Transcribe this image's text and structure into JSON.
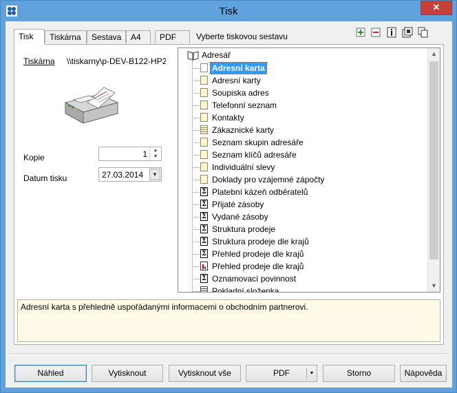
{
  "window": {
    "title": "Tisk",
    "close_label": "✕"
  },
  "tabs": [
    {
      "label": "Tisk",
      "active": true
    },
    {
      "label": "Tiskárna",
      "active": false
    },
    {
      "label": "Sestava",
      "active": false
    },
    {
      "label": "A4",
      "active": false
    },
    {
      "label": "PDF",
      "active": false
    }
  ],
  "tab_caption": "Vyberte tiskovou sestavu",
  "toolbar": [
    {
      "name": "add-icon"
    },
    {
      "name": "remove-icon"
    },
    {
      "name": "info-icon"
    },
    {
      "name": "copy-settings-icon"
    },
    {
      "name": "duplicate-icon"
    }
  ],
  "printer": {
    "label": "Tiskárna",
    "name": "\\\\tiskarny\\p-DEV-B122-HP2"
  },
  "copies": {
    "label": "Kopie",
    "value": "1"
  },
  "print_date": {
    "label": "Datum tisku",
    "value": "27.03.2014"
  },
  "tree": {
    "root": "Adresář",
    "items": [
      {
        "label": "Adresní karta",
        "icon": "white",
        "selected": true
      },
      {
        "label": "Adresní karty",
        "icon": "page"
      },
      {
        "label": "Soupiska adres",
        "icon": "page"
      },
      {
        "label": "Telefonní seznam",
        "icon": "page"
      },
      {
        "label": "Kontakty",
        "icon": "page"
      },
      {
        "label": "Zákaznické karty",
        "icon": "grid"
      },
      {
        "label": "Seznam skupin adresáře",
        "icon": "page"
      },
      {
        "label": "Seznam klíčů adresáře",
        "icon": "page"
      },
      {
        "label": "Individuální slevy",
        "icon": "page"
      },
      {
        "label": "Doklady pro vzájemné zápočty",
        "icon": "page"
      },
      {
        "label": "Platební kázeň odběratelů",
        "icon": "sigma"
      },
      {
        "label": "Přijaté zásoby",
        "icon": "sigma"
      },
      {
        "label": "Vydané zásoby",
        "icon": "sigma"
      },
      {
        "label": "Struktura prodeje",
        "icon": "sigma"
      },
      {
        "label": "Struktura prodeje dle krajů",
        "icon": "sigma"
      },
      {
        "label": "Přehled prodeje dle krajů",
        "icon": "sigma"
      },
      {
        "label": "Přehled prodeje dle krajů",
        "icon": "bars"
      },
      {
        "label": "Oznamovací povinnost",
        "icon": "sigma"
      },
      {
        "label": "Pokladní složenka",
        "icon": "doc"
      }
    ]
  },
  "description": "Adresní karta s přehledně uspořádanými informacemi o obchodním partnerovi.",
  "buttons": {
    "preview": "Náhled",
    "print": "Vytisknout",
    "print_all": "Vytisknout vše",
    "pdf": "PDF",
    "cancel": "Storno",
    "help": "Nápověda"
  },
  "colors": {
    "selection": "#3399ff",
    "description_bg": "#fffbe7",
    "close_button": "#c7413a"
  }
}
